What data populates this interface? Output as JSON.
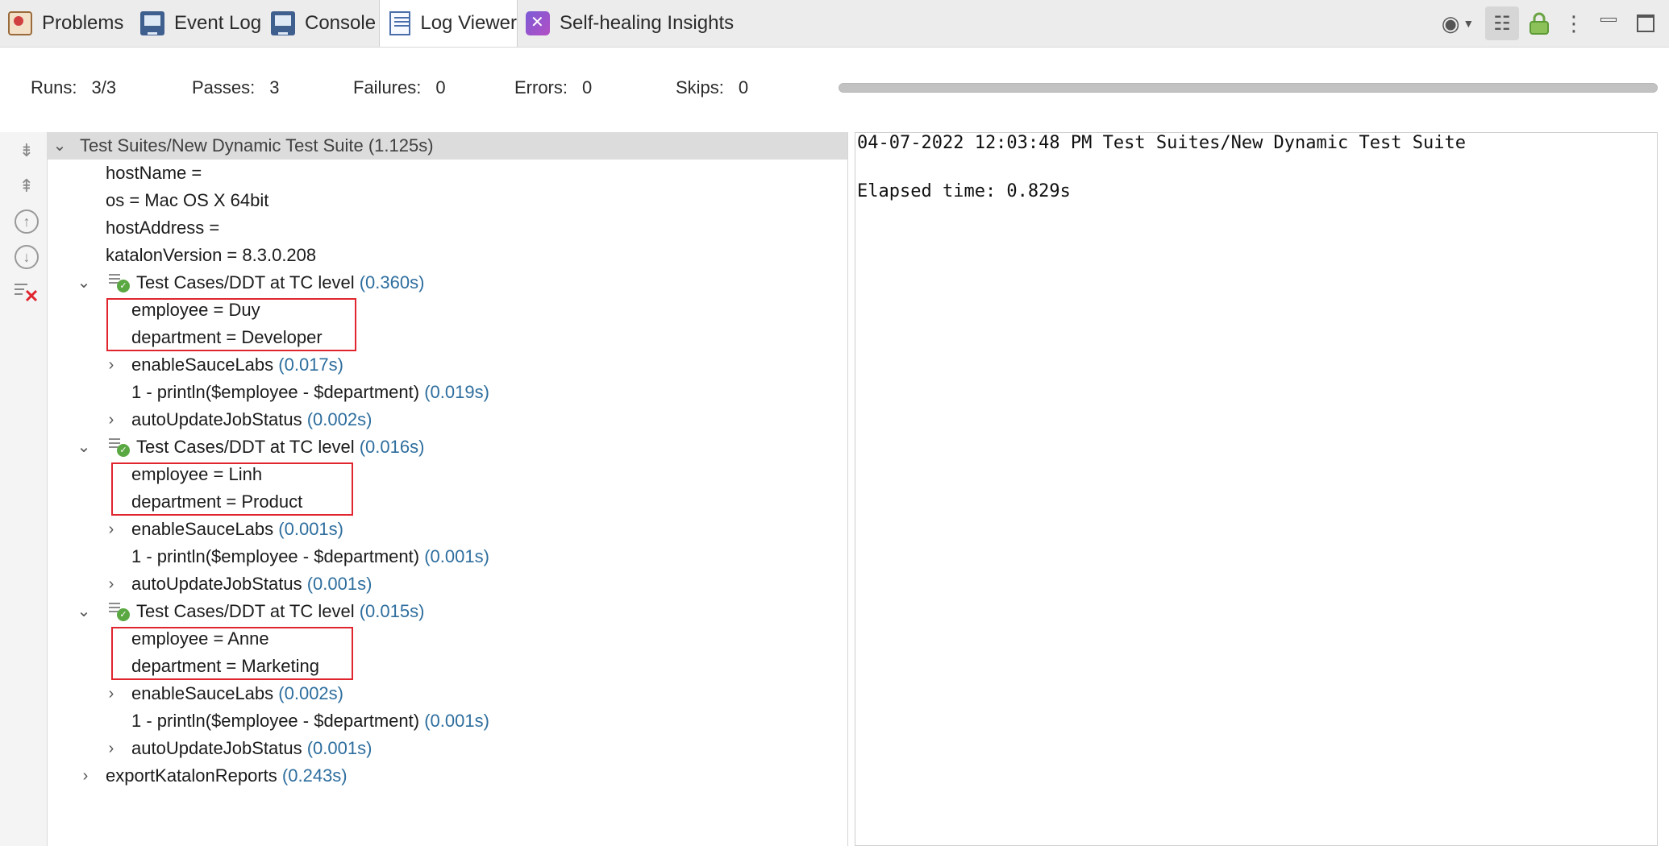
{
  "tabs": [
    {
      "label": "Problems",
      "icon": "problems-icon"
    },
    {
      "label": "Event Log",
      "icon": "monitor-icon"
    },
    {
      "label": "Console",
      "icon": "monitor-icon"
    },
    {
      "label": "Log Viewer",
      "icon": "log-viewer-icon",
      "active": true
    },
    {
      "label": "Self-healing Insights",
      "icon": "self-healing-icon"
    }
  ],
  "summary": {
    "runs_label": "Runs:",
    "runs_value": "3/3",
    "passes_label": "Passes:",
    "passes_value": "3",
    "failures_label": "Failures:",
    "failures_value": "0",
    "errors_label": "Errors:",
    "errors_value": "0",
    "skips_label": "Skips:",
    "skips_value": "0",
    "progress_fraction": 1.0
  },
  "tree": {
    "suite": {
      "name": "Test Suites/New Dynamic Test Suite",
      "duration": "(1.125s)"
    },
    "properties": [
      "hostName =",
      "os = Mac OS X 64bit",
      "hostAddress =",
      "katalonVersion = 8.3.0.208"
    ],
    "cases": [
      {
        "name": "Test Cases/DDT at TC level",
        "duration": "(0.360s)",
        "vars": [
          "employee = Duy",
          "department = Developer"
        ],
        "steps": [
          {
            "name": "enableSauceLabs",
            "duration": "(0.017s)"
          },
          {
            "name": "1 - println($employee - $department)",
            "duration": "(0.019s)"
          },
          {
            "name": "autoUpdateJobStatus",
            "duration": "(0.002s)"
          }
        ]
      },
      {
        "name": "Test Cases/DDT at TC level",
        "duration": "(0.016s)",
        "vars": [
          "employee = Linh",
          "department = Product"
        ],
        "steps": [
          {
            "name": "enableSauceLabs",
            "duration": "(0.001s)"
          },
          {
            "name": "1 - println($employee - $department)",
            "duration": "(0.001s)"
          },
          {
            "name": "autoUpdateJobStatus",
            "duration": "(0.001s)"
          }
        ]
      },
      {
        "name": "Test Cases/DDT at TC level",
        "duration": "(0.015s)",
        "vars": [
          "employee = Anne",
          "department = Marketing"
        ],
        "steps": [
          {
            "name": "enableSauceLabs",
            "duration": "(0.002s)"
          },
          {
            "name": "1 - println($employee - $department)",
            "duration": "(0.001s)"
          },
          {
            "name": "autoUpdateJobStatus",
            "duration": "(0.001s)"
          }
        ]
      }
    ],
    "footer": {
      "name": "exportKatalonReports",
      "duration": "(0.243s)"
    }
  },
  "detail": {
    "header": "04-07-2022 12:03:48 PM Test Suites/New Dynamic Test Suite",
    "elapsed": "Elapsed time: 0.829s"
  },
  "colors": {
    "highlight": "#e0252f",
    "duration": "#2e6e9e",
    "pass": "#5aa842"
  }
}
